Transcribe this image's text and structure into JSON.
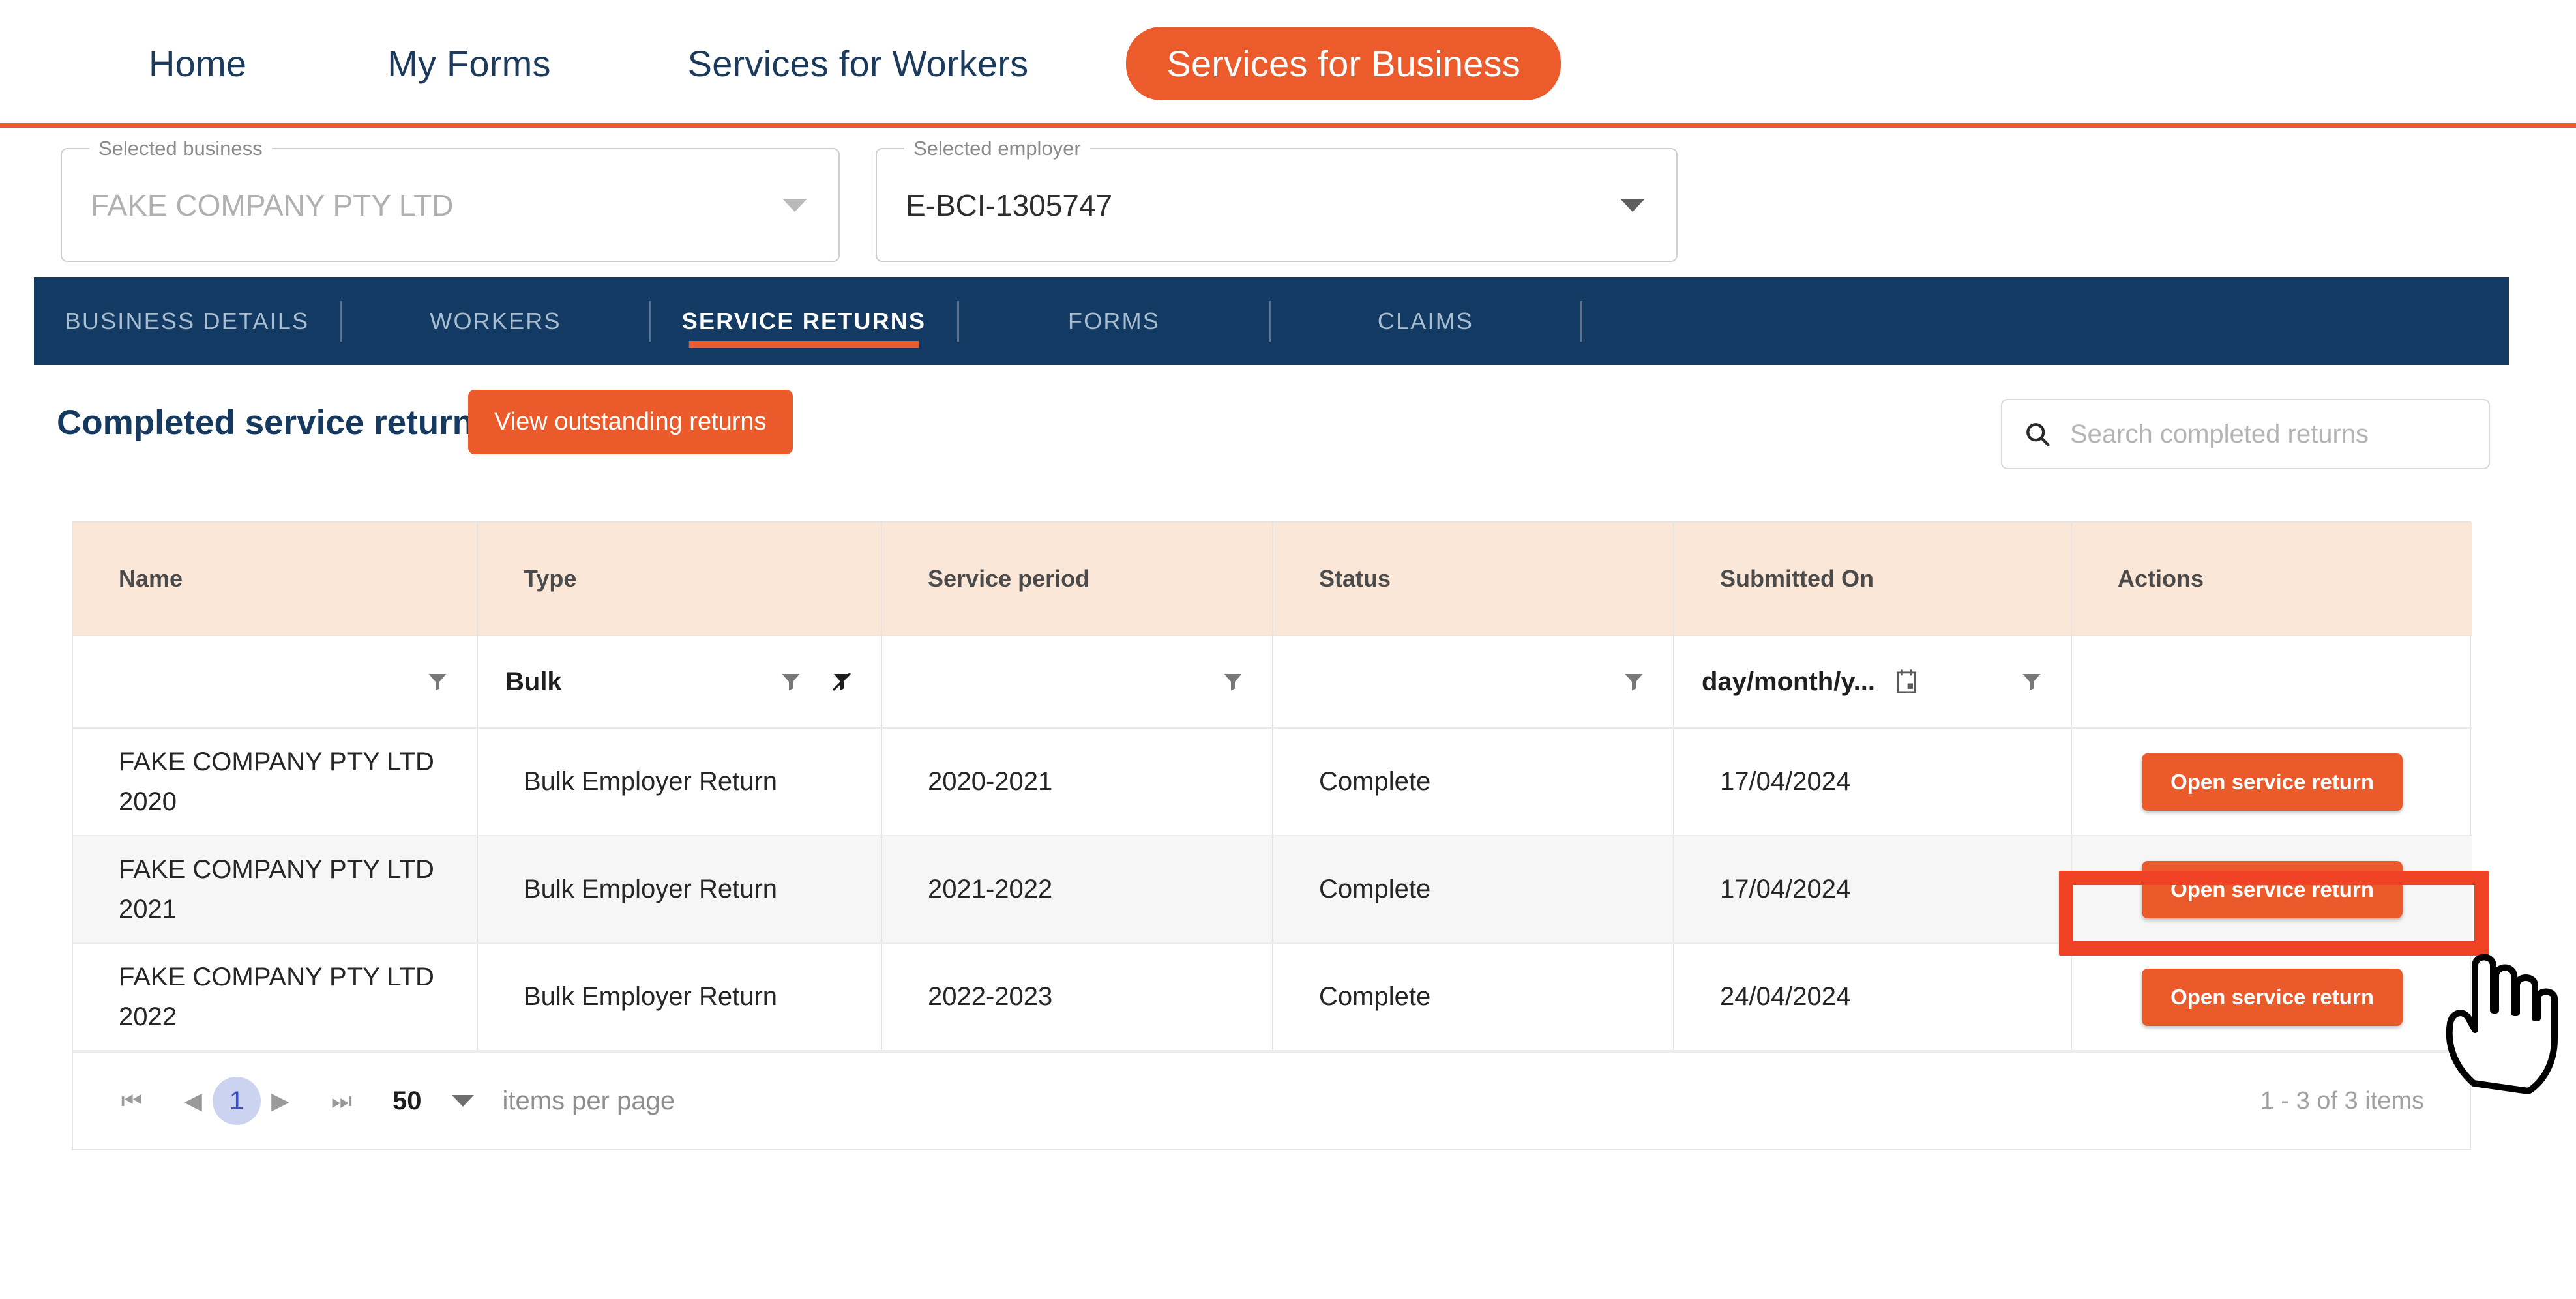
{
  "topnav": {
    "items": [
      {
        "label": "Home",
        "active": false
      },
      {
        "label": "My Forms",
        "active": false
      },
      {
        "label": "Services for Workers",
        "active": false
      },
      {
        "label": "Services for Business",
        "active": true
      }
    ]
  },
  "selectors": {
    "business": {
      "legend": "Selected business",
      "value": "FAKE COMPANY PTY LTD",
      "caret_icon": "chevron-down-icon"
    },
    "employer": {
      "legend": "Selected employer",
      "value": "E-BCI-1305747",
      "caret_icon": "chevron-down-icon"
    }
  },
  "tabs": [
    {
      "label": "BUSINESS DETAILS",
      "active": false
    },
    {
      "label": "WORKERS",
      "active": false
    },
    {
      "label": "SERVICE RETURNS",
      "active": true
    },
    {
      "label": "FORMS",
      "active": false
    },
    {
      "label": "CLAIMS",
      "active": false
    }
  ],
  "section": {
    "title": "Completed service returns",
    "outstanding_button": "View outstanding returns"
  },
  "search": {
    "placeholder": "Search completed returns",
    "value": "",
    "icon": "search-icon"
  },
  "table": {
    "columns": [
      "Name",
      "Type",
      "Service period",
      "Status",
      "Submitted On",
      "Actions"
    ],
    "filters": {
      "name": {
        "value": "",
        "filter_icon": "filter-icon"
      },
      "type": {
        "value": "Bulk",
        "filter_icon": "filter-icon",
        "clear_icon": "filter-clear-icon"
      },
      "service_period": {
        "value": "",
        "filter_icon": "filter-icon"
      },
      "status": {
        "value": "",
        "filter_icon": "filter-icon"
      },
      "submitted_on": {
        "value": "day/month/y...",
        "calendar_icon": "calendar-icon",
        "filter_icon": "filter-icon"
      },
      "actions": {
        "value": ""
      }
    },
    "rows": [
      {
        "name": "FAKE COMPANY PTY LTD 2020",
        "type": "Bulk Employer Return",
        "service_period": "2020-2021",
        "status": "Complete",
        "submitted_on": "17/04/2024",
        "action_label": "Open service return",
        "highlighted": false
      },
      {
        "name": "FAKE COMPANY PTY LTD 2021",
        "type": "Bulk Employer Return",
        "service_period": "2021-2022",
        "status": "Complete",
        "submitted_on": "17/04/2024",
        "action_label": "Open service return",
        "highlighted": true
      },
      {
        "name": "FAKE COMPANY PTY LTD 2022",
        "type": "Bulk Employer Return",
        "service_period": "2022-2023",
        "status": "Complete",
        "submitted_on": "24/04/2024",
        "action_label": "Open service return",
        "highlighted": false
      }
    ]
  },
  "pagination": {
    "first_icon": "first-page-icon",
    "prev_icon": "previous-page-icon",
    "current_page": "1",
    "next_icon": "next-page-icon",
    "last_icon": "last-page-icon",
    "page_size": "50",
    "page_size_caret": "chevron-down-icon",
    "items_per_page_label": "items per page",
    "item_count": "1 - 3 of 3 items"
  },
  "annotation": {
    "target_row_index": 1,
    "box_color": "#ef4123",
    "cursor_icon": "pointing-hand-cursor"
  },
  "colors": {
    "brand_orange": "#ea5a2a",
    "navy": "#123a63",
    "header_peach": "#fbe7d7",
    "page_pill": "#ccd3f0",
    "annotation_red": "#ef4123"
  }
}
